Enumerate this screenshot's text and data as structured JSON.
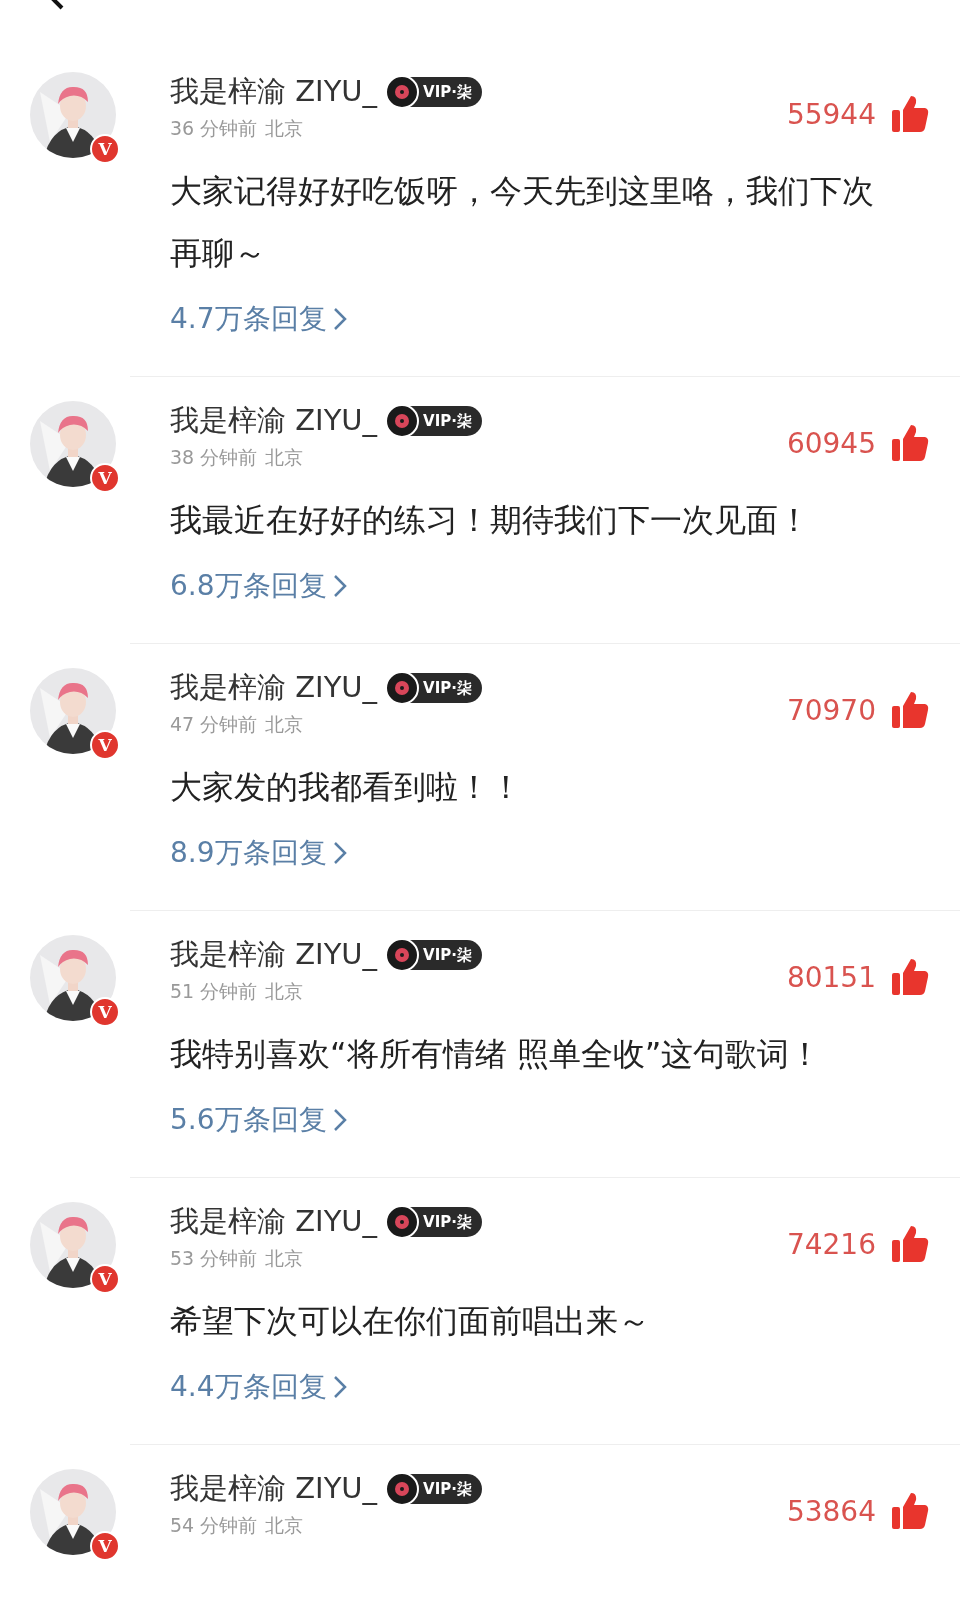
{
  "comments": [
    {
      "name": "我是梓渝 ZIYU_",
      "verified_badge": "V",
      "vip": "VIP·柒",
      "time": "36 分钟前",
      "location": "北京",
      "likes": "55944",
      "text": "大家记得好好吃饭呀，今天先到这里咯，我们下次再聊～",
      "replies": "4.7万条回复"
    },
    {
      "name": "我是梓渝 ZIYU_",
      "verified_badge": "V",
      "vip": "VIP·柒",
      "time": "38 分钟前",
      "location": "北京",
      "likes": "60945",
      "text": "我最近在好好的练习！期待我们下一次见面！",
      "replies": "6.8万条回复"
    },
    {
      "name": "我是梓渝 ZIYU_",
      "verified_badge": "V",
      "vip": "VIP·柒",
      "time": "47 分钟前",
      "location": "北京",
      "likes": "70970",
      "text": "大家发的我都看到啦！！",
      "replies": "8.9万条回复"
    },
    {
      "name": "我是梓渝 ZIYU_",
      "verified_badge": "V",
      "vip": "VIP·柒",
      "time": "51 分钟前",
      "location": "北京",
      "likes": "80151",
      "text": "我特别喜欢“将所有情绪 照单全收”这句歌词！",
      "replies": "5.6万条回复"
    },
    {
      "name": "我是梓渝 ZIYU_",
      "verified_badge": "V",
      "vip": "VIP·柒",
      "time": "53 分钟前",
      "location": "北京",
      "likes": "74216",
      "text": "希望下次可以在你们面前唱出来～",
      "replies": "4.4万条回复"
    },
    {
      "name": "我是梓渝 ZIYU_",
      "verified_badge": "V",
      "vip": "VIP·柒",
      "time": "54 分钟前",
      "location": "北京",
      "likes": "53864"
    }
  ]
}
